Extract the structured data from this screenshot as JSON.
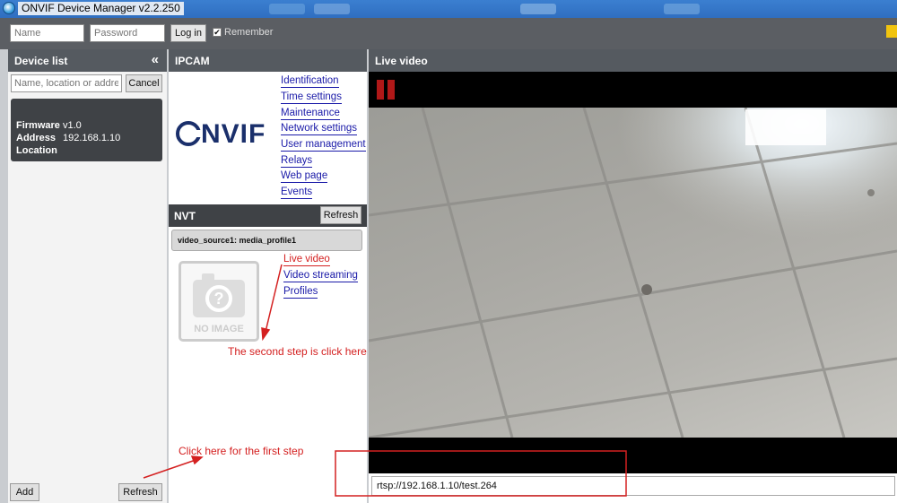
{
  "window": {
    "title": "ONVIF Device Manager v2.2.250"
  },
  "login": {
    "name_placeholder": "Name",
    "password_placeholder": "Password",
    "login_label": "Log in",
    "remember_label": "Remember",
    "remember_checked": true
  },
  "device_list": {
    "title": "Device list",
    "collapse_glyph": "«",
    "search_placeholder": "Name, location or address",
    "cancel_label": "Cancel",
    "device": {
      "firmware_key": "Firmware",
      "firmware_value": "v1.0",
      "address_key": "Address",
      "address_value": "192.168.1.10",
      "location_key": "Location",
      "location_value": ""
    },
    "add_label": "Add",
    "refresh_label": "Refresh"
  },
  "ipcam": {
    "title": "IPCAM",
    "logo_text": "NVIF",
    "menu": [
      "Identification",
      "Time settings",
      "Maintenance",
      "Network settings",
      "User management",
      "Relays",
      "Web page",
      "Events"
    ],
    "nvt": {
      "title": "NVT",
      "refresh_label": "Refresh",
      "profile_label": "video_source1: media_profile1",
      "no_image_label": "NO IMAGE",
      "links": [
        "Live video",
        "Video streaming",
        "Profiles"
      ]
    }
  },
  "live_video": {
    "title": "Live video",
    "stream_url": "rtsp://192.168.1.10/test.264"
  },
  "annotations": {
    "step2": "The second step is click here",
    "step1": "Click here for the first step"
  },
  "colors": {
    "annotation_red": "#d42020",
    "header_gray": "#555a60",
    "link_blue": "#1a1aa8",
    "pause_red": "#b01818"
  }
}
